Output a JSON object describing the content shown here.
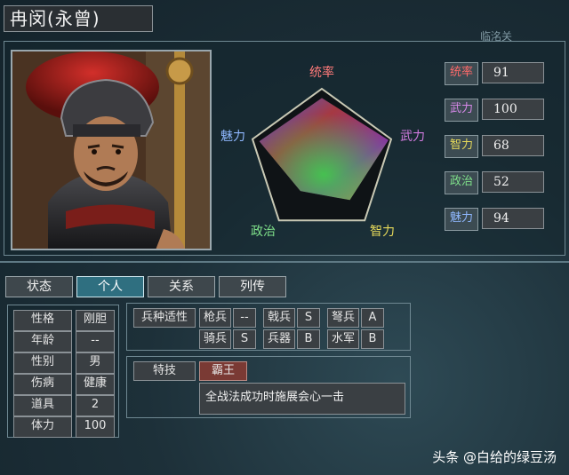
{
  "header": {
    "name": "冉闵(永曾)",
    "faint_label": "临洺关"
  },
  "radar": {
    "labels": {
      "top": "统率",
      "right": "武力",
      "bottom_right": "智力",
      "bottom_left": "政治",
      "left": "魅力"
    },
    "label_colors": {
      "top": "#ff7a7a",
      "right": "#d27be0",
      "bottom_right": "#e6d95a",
      "bottom_left": "#7fe08a",
      "left": "#8fb8ff"
    },
    "values": [
      91,
      100,
      68,
      52,
      94
    ],
    "max": 100
  },
  "stats": [
    {
      "label": "统率",
      "value": "91",
      "color": "#ff6a6a"
    },
    {
      "label": "武力",
      "value": "100",
      "color": "#d889ea"
    },
    {
      "label": "智力",
      "value": "68",
      "color": "#e6d95a"
    },
    {
      "label": "政治",
      "value": "52",
      "color": "#7fe08a"
    },
    {
      "label": "魅力",
      "value": "94",
      "color": "#8fb8ff"
    }
  ],
  "tabs": [
    {
      "label": "状态",
      "active": false
    },
    {
      "label": "个人",
      "active": true
    },
    {
      "label": "关系",
      "active": false
    },
    {
      "label": "列传",
      "active": false
    }
  ],
  "personal": [
    {
      "label": "性格",
      "value": "刚胆"
    },
    {
      "label": "年龄",
      "value": "--"
    },
    {
      "label": "性别",
      "value": "男"
    },
    {
      "label": "伤病",
      "value": "健康"
    },
    {
      "label": "道具",
      "value": "2"
    },
    {
      "label": "体力",
      "value": "100"
    }
  ],
  "aptitude": {
    "title": "兵种适性",
    "rows": [
      [
        {
          "unit": "枪兵",
          "grade": "--"
        },
        {
          "unit": "戟兵",
          "grade": "S"
        },
        {
          "unit": "弩兵",
          "grade": "A"
        }
      ],
      [
        {
          "unit": "骑兵",
          "grade": "S"
        },
        {
          "unit": "兵器",
          "grade": "B"
        },
        {
          "unit": "水军",
          "grade": "B"
        }
      ]
    ]
  },
  "skill": {
    "title": "特技",
    "name": "霸王",
    "description": "全战法成功时施展会心一击"
  },
  "watermark": "头条 @白给的绿豆汤"
}
